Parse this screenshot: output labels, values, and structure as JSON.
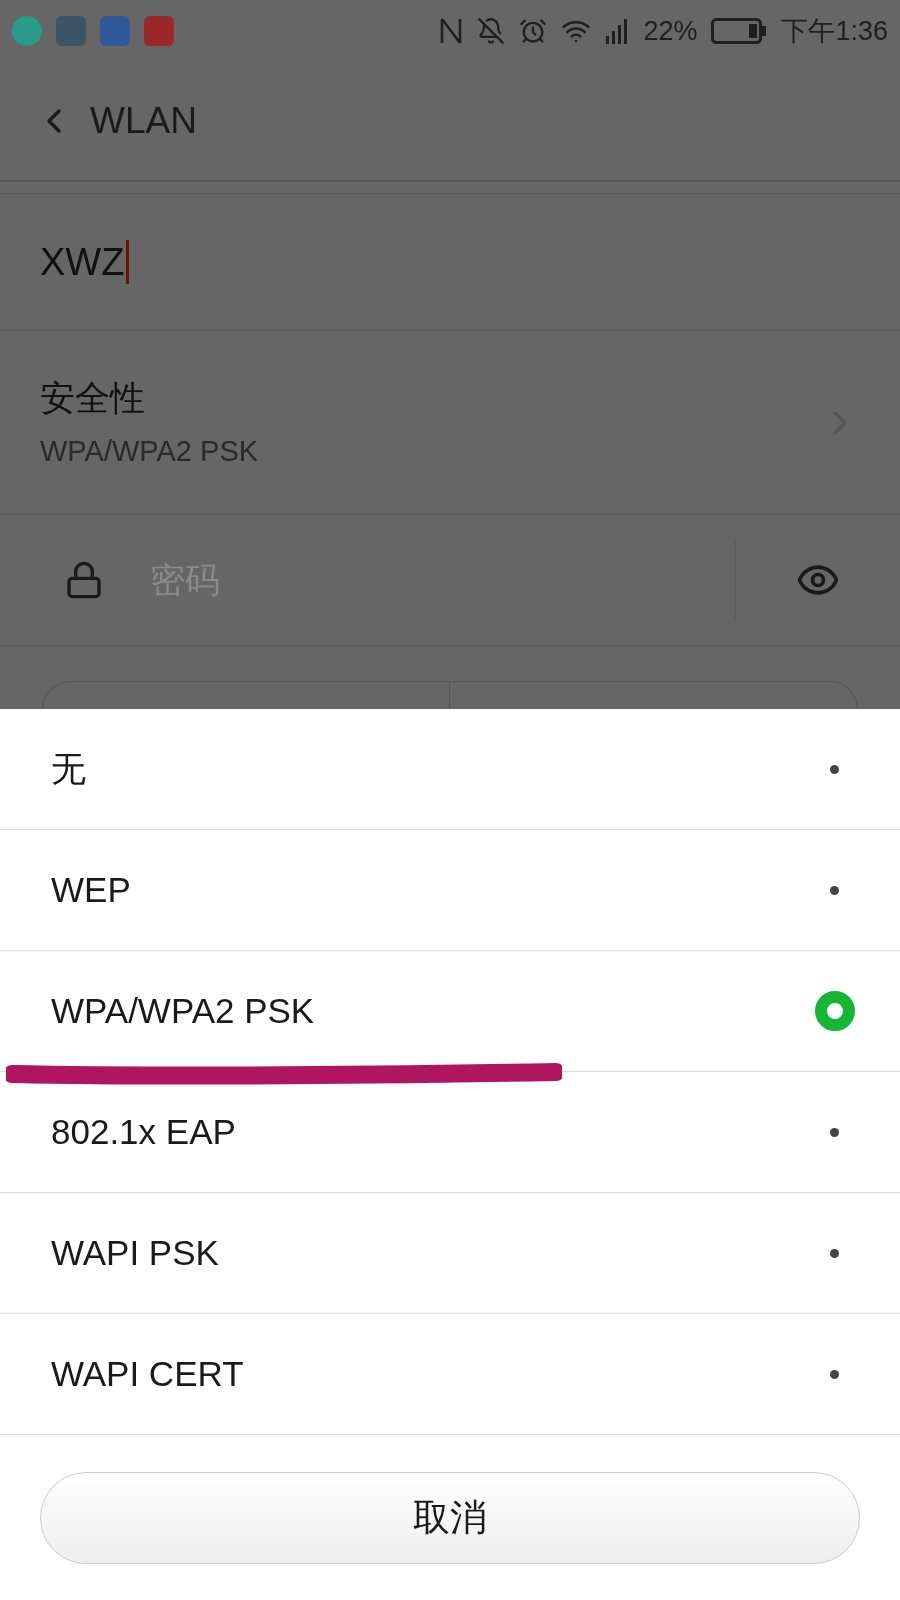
{
  "status_bar": {
    "battery": "22%",
    "time": "下午1:36"
  },
  "header": {
    "title": "WLAN"
  },
  "ssid_field": {
    "value": "XWZ"
  },
  "security": {
    "label": "安全性",
    "value": "WPA/WPA2 PSK"
  },
  "password_field": {
    "placeholder": "密码"
  },
  "options": [
    {
      "label": "无",
      "selected": false
    },
    {
      "label": "WEP",
      "selected": false
    },
    {
      "label": "WPA/WPA2 PSK",
      "selected": true
    },
    {
      "label": "802.1x EAP",
      "selected": false
    },
    {
      "label": "WAPI PSK",
      "selected": false
    },
    {
      "label": "WAPI CERT",
      "selected": false
    }
  ],
  "cancel_button": "取消"
}
